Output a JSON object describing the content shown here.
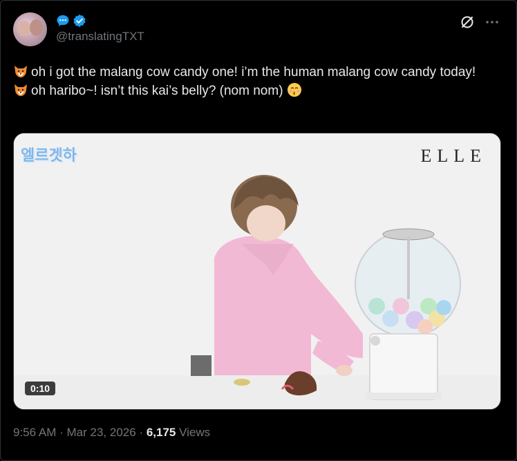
{
  "author": {
    "handle": "@translatingTXT",
    "avatar_icon": "profile-avatar",
    "badges": [
      "chat-bubble-icon",
      "verified-badge-icon"
    ]
  },
  "toolbar": {
    "grok_icon": "slashed-circle-icon",
    "more_icon": "more-options-icon"
  },
  "tweet": {
    "line1": "oh i got the malang cow candy one! i’m the human malang cow candy today!",
    "line2": "oh haribo~! isn’t this kai’s belly? (nom nom)",
    "emoji_fox": "fox-emoji",
    "emoji_kiss": "kissing-face-emoji"
  },
  "media": {
    "brand_logo": "ELLE",
    "show_logo": "엘르겟하",
    "duration": "0:10"
  },
  "meta": {
    "time": "9:56 AM",
    "separator1": "·",
    "date": "Mar 23, 2026",
    "separator2": "·",
    "views_count": "6,175",
    "views_label": "Views"
  },
  "colors": {
    "background": "#000000",
    "text": "#e7e9ea",
    "muted": "#71767b",
    "verified": "#1d9bf0",
    "border": "#2f3336"
  }
}
